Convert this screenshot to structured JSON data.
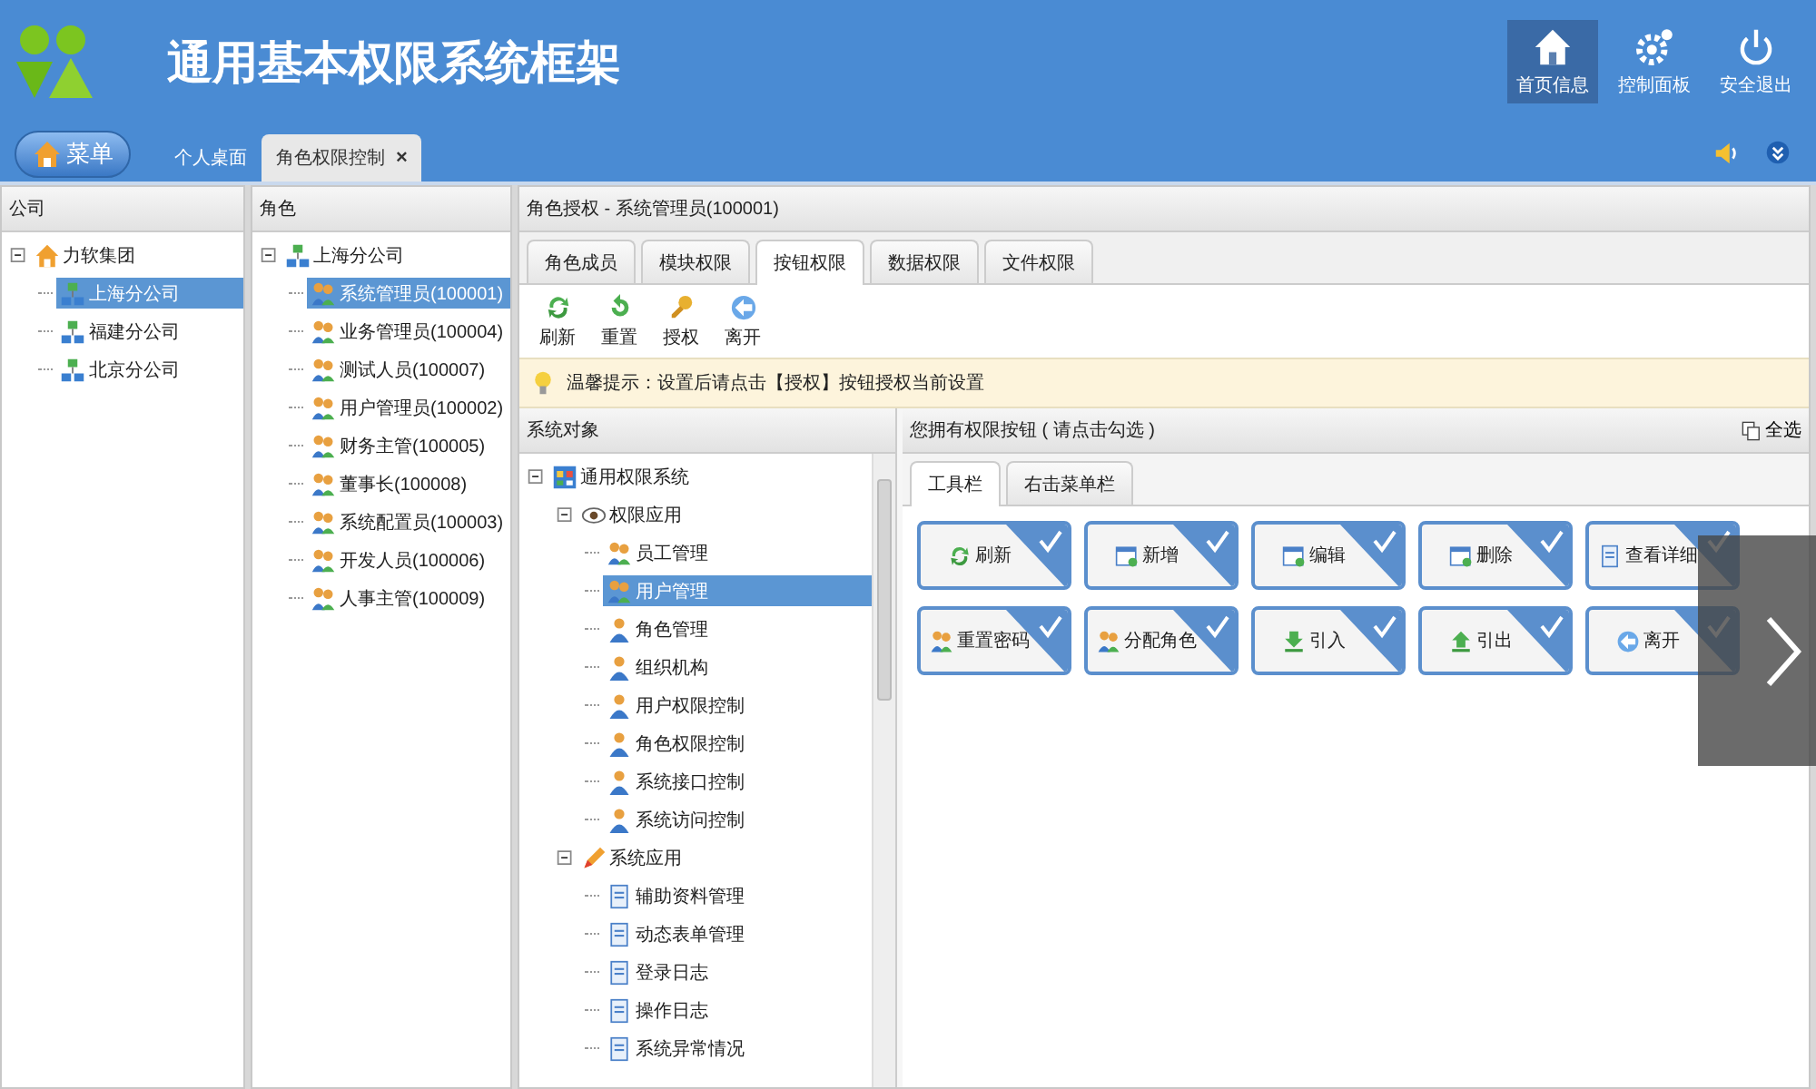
{
  "header": {
    "title": "通用基本权限系统框架",
    "nav": [
      {
        "label": "首页信息",
        "selected": true
      },
      {
        "label": "控制面板",
        "selected": false
      },
      {
        "label": "安全退出",
        "selected": false
      }
    ]
  },
  "menu_button": "菜单",
  "tabs": [
    {
      "label": "个人桌面",
      "selected": false
    },
    {
      "label": "角色权限控制",
      "selected": true,
      "close": "×"
    }
  ],
  "company_panel": {
    "title": "公司",
    "tree": [
      {
        "label": "力软集团",
        "expanded": true,
        "selected": false,
        "children": [
          {
            "label": "上海分公司",
            "selected": true
          },
          {
            "label": "福建分公司",
            "selected": false
          },
          {
            "label": "北京分公司",
            "selected": false
          }
        ]
      }
    ]
  },
  "role_panel": {
    "title": "角色",
    "tree": [
      {
        "label": "上海分公司",
        "expanded": true,
        "selected": false,
        "children": [
          {
            "label": "系统管理员(100001)",
            "selected": true
          },
          {
            "label": "业务管理员(100004)",
            "selected": false
          },
          {
            "label": "测试人员(100007)",
            "selected": false
          },
          {
            "label": "用户管理员(100002)",
            "selected": false
          },
          {
            "label": "财务主管(100005)",
            "selected": false
          },
          {
            "label": "董事长(100008)",
            "selected": false
          },
          {
            "label": "系统配置员(100003)",
            "selected": false
          },
          {
            "label": "开发人员(100006)",
            "selected": false
          },
          {
            "label": "人事主管(100009)",
            "selected": false
          }
        ]
      }
    ]
  },
  "auth_panel": {
    "title": "角色授权 - 系统管理员(100001)",
    "tabs": [
      {
        "label": "角色成员",
        "selected": false
      },
      {
        "label": "模块权限",
        "selected": false
      },
      {
        "label": "按钮权限",
        "selected": true
      },
      {
        "label": "数据权限",
        "selected": false
      },
      {
        "label": "文件权限",
        "selected": false
      }
    ],
    "toolbar": [
      "刷新",
      "重置",
      "授权",
      "离开"
    ],
    "tip": "温馨提示：设置后请点击【授权】按钮授权当前设置",
    "objects": {
      "title": "系统对象",
      "tree": [
        {
          "label": "通用权限系统",
          "expanded": true,
          "selected": false,
          "children": [
            {
              "label": "权限应用",
              "expanded": true,
              "selected": false,
              "children": [
                {
                  "label": "员工管理",
                  "selected": false
                },
                {
                  "label": "用户管理",
                  "selected": true
                },
                {
                  "label": "角色管理",
                  "selected": false
                },
                {
                  "label": "组织机构",
                  "selected": false
                },
                {
                  "label": "用户权限控制",
                  "selected": false
                },
                {
                  "label": "角色权限控制",
                  "selected": false
                },
                {
                  "label": "系统接口控制",
                  "selected": false
                },
                {
                  "label": "系统访问控制",
                  "selected": false
                }
              ]
            },
            {
              "label": "系统应用",
              "expanded": true,
              "selected": false,
              "children": [
                {
                  "label": "辅助资料管理",
                  "selected": false
                },
                {
                  "label": "动态表单管理",
                  "selected": false
                },
                {
                  "label": "登录日志",
                  "selected": false
                },
                {
                  "label": "操作日志",
                  "selected": false
                },
                {
                  "label": "系统异常情况",
                  "selected": false
                }
              ]
            }
          ]
        }
      ]
    },
    "buttons": {
      "title": "您拥有权限按钮 ( 请点击勾选 )",
      "select_all": "全选",
      "tabs": [
        {
          "label": "工具栏",
          "selected": true
        },
        {
          "label": "右击菜单栏",
          "selected": false
        }
      ],
      "items": [
        {
          "label": "刷新",
          "checked": true
        },
        {
          "label": "新增",
          "checked": true
        },
        {
          "label": "编辑",
          "checked": true
        },
        {
          "label": "删除",
          "checked": true
        },
        {
          "label": "查看详细",
          "checked": true
        },
        {
          "label": "重置密码",
          "checked": true
        },
        {
          "label": "分配角色",
          "checked": true
        },
        {
          "label": "引入",
          "checked": true
        },
        {
          "label": "引出",
          "checked": true
        },
        {
          "label": "离开",
          "checked": true
        }
      ]
    }
  }
}
